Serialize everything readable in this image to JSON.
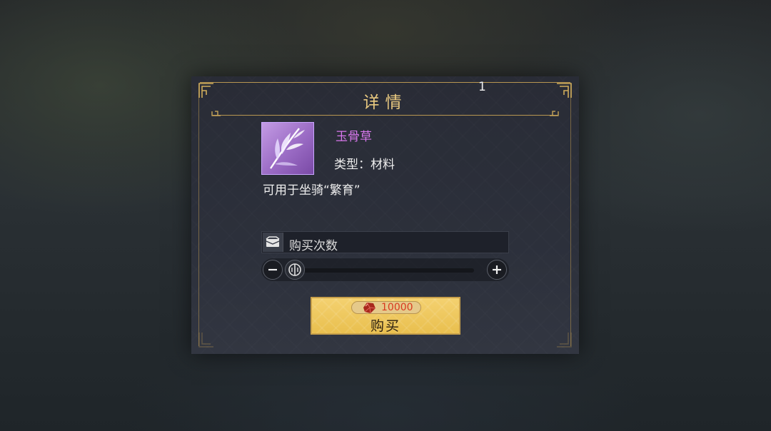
{
  "dialog": {
    "title": "详情"
  },
  "item": {
    "icon": "grass-herb-icon",
    "name": "玉骨草",
    "type": "类型：材料",
    "description": "可用于坐骑“繁育”",
    "name_color": "#d978ee"
  },
  "purchase": {
    "count_icon": "chest-icon",
    "count_label": "购买次数",
    "count_value": "1",
    "slider_fraction": 0.0
  },
  "buy_button": {
    "currency_icon": "red-gem-icon",
    "price": "10000",
    "label": "购买",
    "price_color": "#d93a1e"
  }
}
